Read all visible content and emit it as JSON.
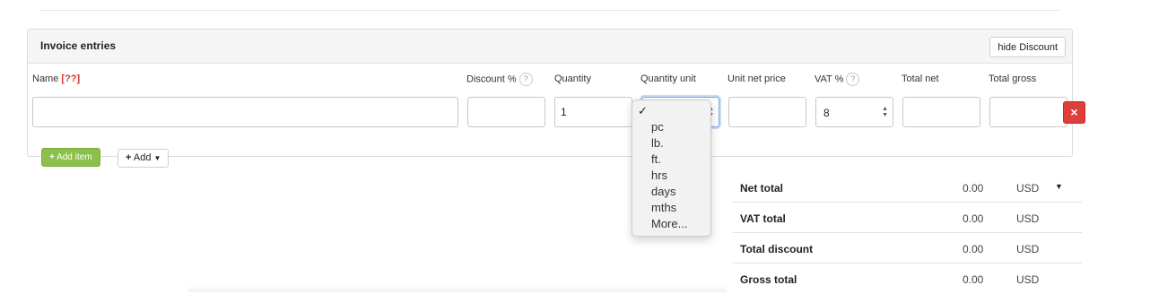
{
  "panel": {
    "title": "Invoice entries",
    "hide_discount_label": "hide Discount"
  },
  "columns": {
    "name": "Name",
    "name_required": "[??]",
    "discount": "Discount %",
    "quantity": "Quantity",
    "quantity_unit": "Quantity unit",
    "unit_net_price": "Unit net price",
    "vat": "VAT %",
    "total_net": "Total net",
    "total_gross": "Total gross",
    "help_mark": "?"
  },
  "row": {
    "name": "",
    "discount": "",
    "quantity": "1",
    "quantity_unit": "",
    "unit_net_price": "",
    "vat": "8",
    "total_net": "",
    "total_gross": ""
  },
  "buttons": {
    "delete_glyph": "×",
    "add_item": "Add item",
    "add": "Add"
  },
  "unit_dropdown": {
    "checked_option": "",
    "options": [
      "pc",
      "lb.",
      "ft.",
      "hrs",
      "days",
      "mths",
      "More..."
    ]
  },
  "totals": [
    {
      "label": "Net total",
      "amount": "0.00",
      "currency": "USD"
    },
    {
      "label": "VAT total",
      "amount": "0.00",
      "currency": "USD"
    },
    {
      "label": "Total discount",
      "amount": "0.00",
      "currency": "USD"
    },
    {
      "label": "Gross total",
      "amount": "0.00",
      "currency": "USD"
    }
  ],
  "colors": {
    "add_item_green": "#8cc04b",
    "delete_red": "#e03d3d",
    "required_red": "#d33333"
  }
}
